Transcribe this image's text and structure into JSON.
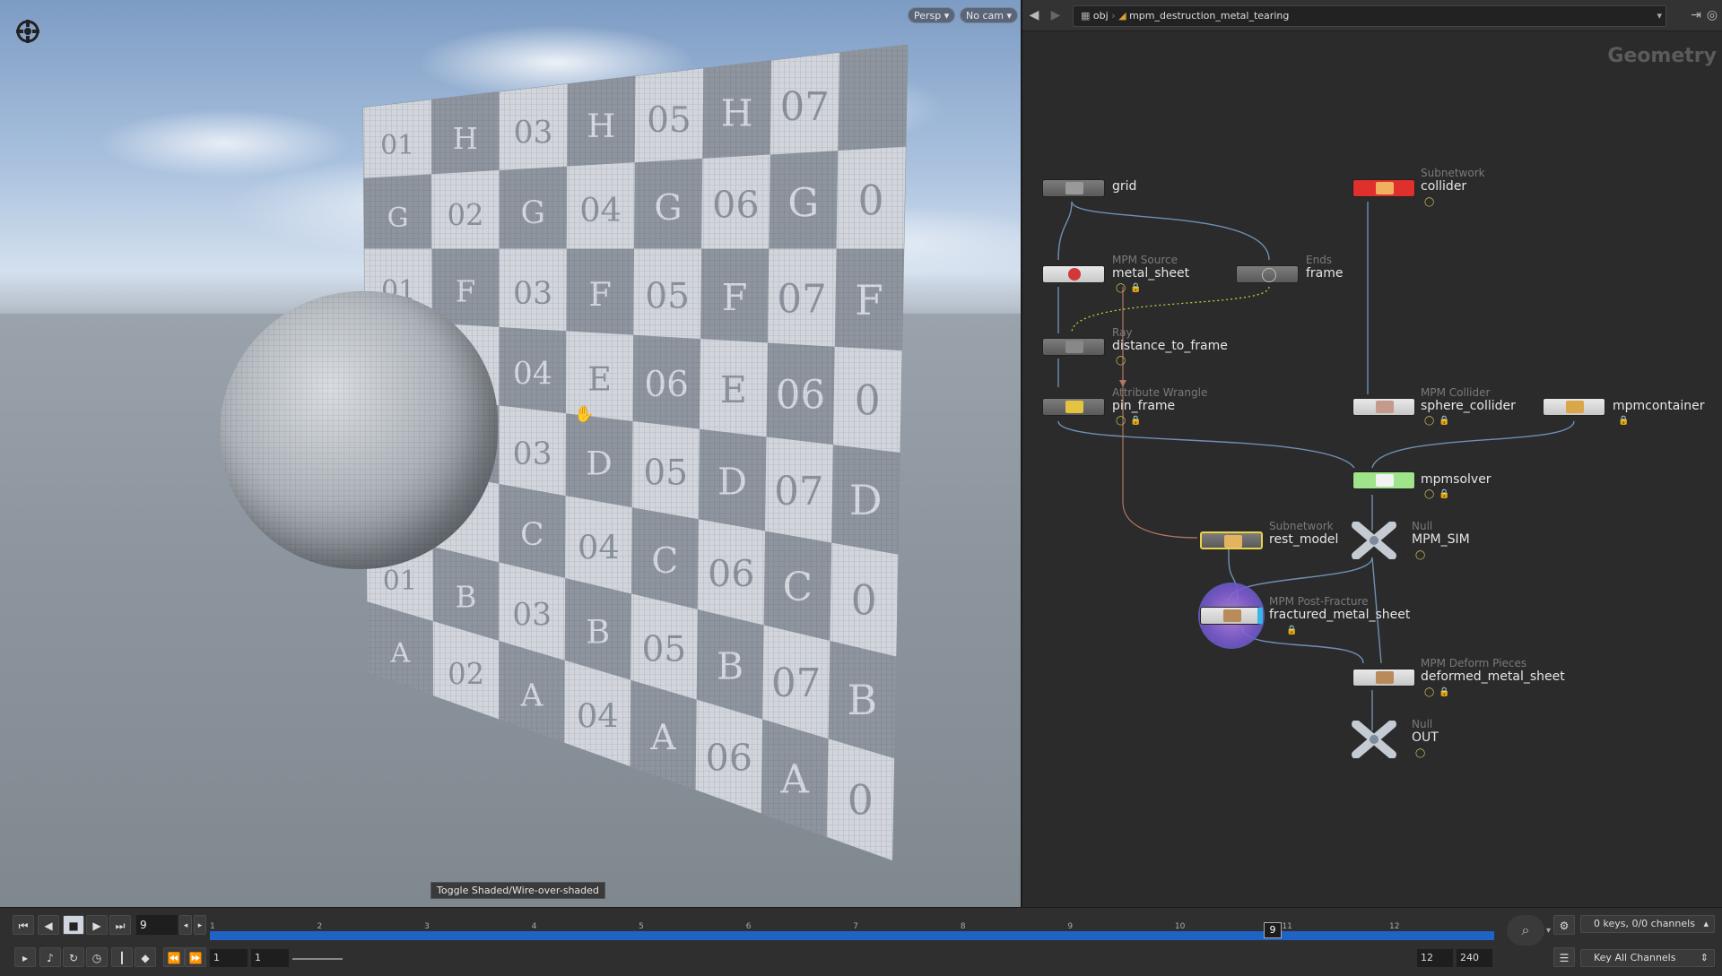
{
  "viewport": {
    "camera_label": "Persp",
    "cam_select_label": "No cam",
    "tooltip": "Toggle Shaded/Wire-over-shaded",
    "sheet_tiles": [
      [
        "01",
        "H",
        "03",
        "H",
        "05",
        "H",
        "07",
        ""
      ],
      [
        "G",
        "02",
        "G",
        "04",
        "G",
        "06",
        "G",
        "0"
      ],
      [
        "01",
        "F",
        "03",
        "F",
        "05",
        "F",
        "07",
        "F"
      ],
      [
        "",
        "E",
        "04",
        "E",
        "06",
        "E",
        "06",
        "0"
      ],
      [
        "",
        "",
        "03",
        "D",
        "05",
        "D",
        "07",
        "D"
      ],
      [
        "",
        "",
        "C",
        "04",
        "C",
        "06",
        "C",
        "0"
      ],
      [
        "01",
        "B",
        "03",
        "B",
        "05",
        "B",
        "07",
        "B"
      ],
      [
        "A",
        "02",
        "A",
        "04",
        "A",
        "06",
        "A",
        "0"
      ]
    ]
  },
  "network": {
    "path": {
      "obj": "obj",
      "name": "mpm_destruction_metal_tearing"
    },
    "context_title": "Geometry",
    "nodes": {
      "grid": {
        "type": "",
        "name": "grid"
      },
      "collider": {
        "type": "Subnetwork",
        "name": "collider"
      },
      "metal_sheet": {
        "type": "MPM Source",
        "name": "metal_sheet"
      },
      "frame": {
        "type": "Ends",
        "name": "frame"
      },
      "distance_to_frame": {
        "type": "Ray",
        "name": "distance_to_frame"
      },
      "pin_frame": {
        "type": "Attribute Wrangle",
        "name": "pin_frame"
      },
      "sphere_collider": {
        "type": "MPM Collider",
        "name": "sphere_collider"
      },
      "mpmcontainer": {
        "type": "",
        "name": "mpmcontainer"
      },
      "mpmsolver": {
        "type": "",
        "name": "mpmsolver"
      },
      "rest_model": {
        "type": "Subnetwork",
        "name": "rest_model"
      },
      "mpm_sim": {
        "type": "Null",
        "name": "MPM_SIM"
      },
      "fractured_metal_sheet": {
        "type": "MPM Post-Fracture",
        "name": "fractured_metal_sheet"
      },
      "deformed_metal_sheet": {
        "type": "MPM Deform Pieces",
        "name": "deformed_metal_sheet"
      },
      "out": {
        "type": "Null",
        "name": "OUT"
      }
    }
  },
  "timeline": {
    "current_frame": "9",
    "marker": "9",
    "tick_labels": [
      "1",
      "2",
      "3",
      "4",
      "5",
      "6",
      "7",
      "8",
      "9",
      "10",
      "11",
      "12"
    ],
    "range_start": "1",
    "range_start2": "1",
    "range_end": "12",
    "range_end2": "240",
    "keys_label": "0 keys, 0/0 channels",
    "key_all_label": "Key All Channels"
  },
  "colors": {
    "collider_node": "#e0302e",
    "solver_node": "#9fe38a",
    "rest_model_outline": "#e8d24a",
    "timeline_bar": "#1f63c6"
  }
}
